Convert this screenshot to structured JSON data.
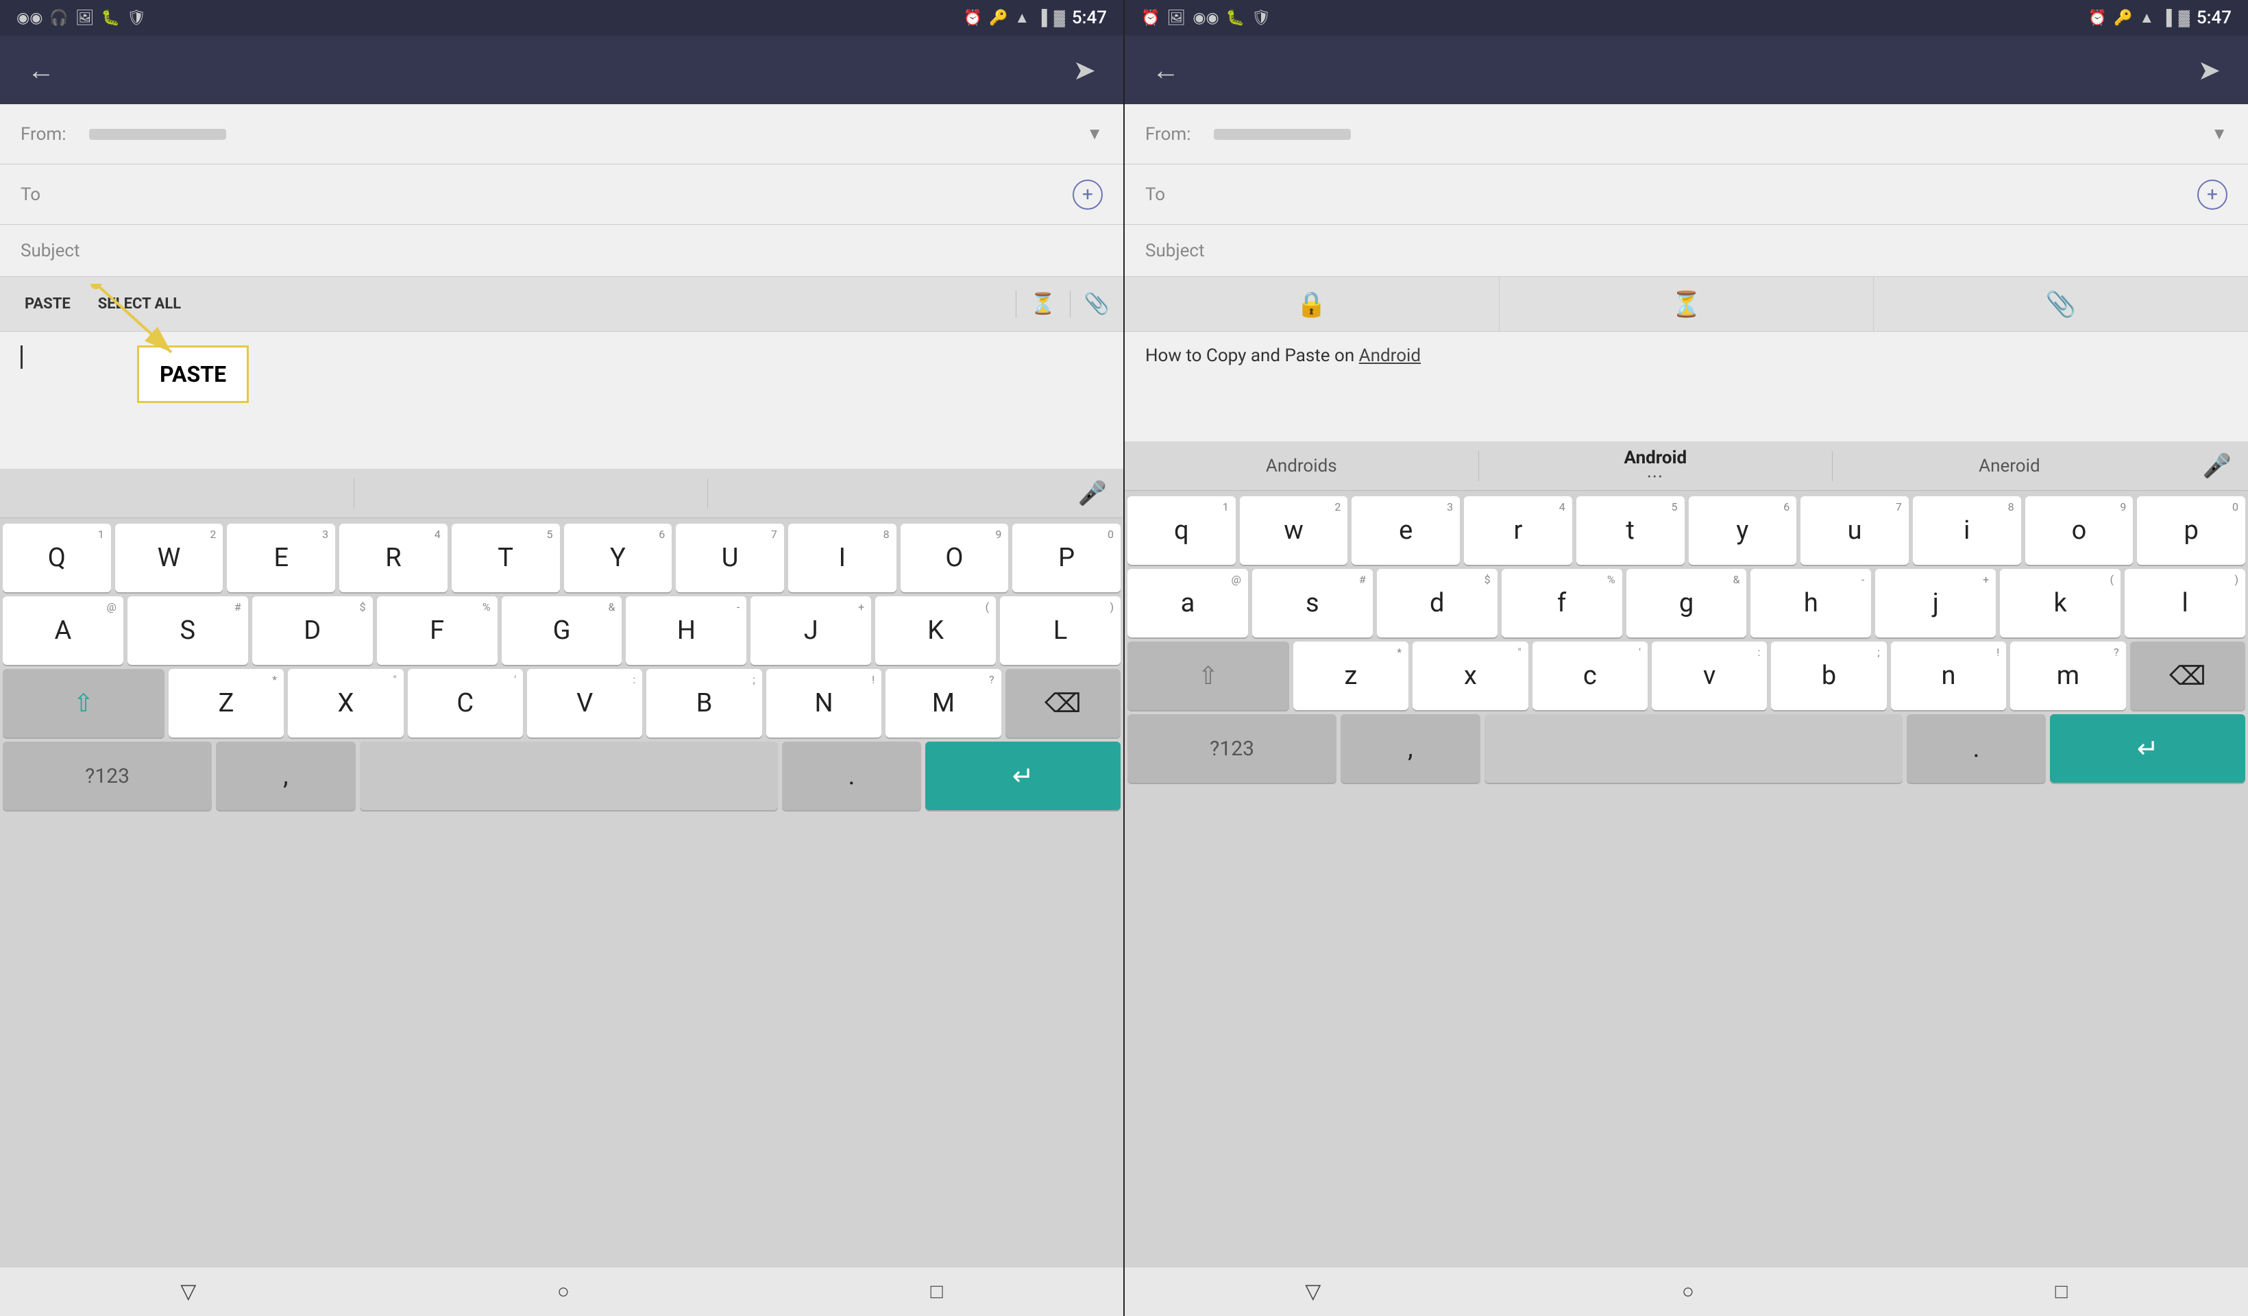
{
  "left_phone": {
    "status_bar": {
      "time": "5:47",
      "icons_left": [
        "voicemail",
        "headset",
        "image",
        "bug",
        "shield"
      ],
      "icons_right": [
        "alarm",
        "key",
        "wifi",
        "signal",
        "battery"
      ]
    },
    "app_bar": {
      "back_label": "←",
      "send_label": "➤"
    },
    "from_label": "From:",
    "to_label": "To",
    "subject_label": "Subject",
    "toolbar": {
      "paste_label": "PASTE",
      "select_all_label": "SELECT ALL",
      "timer_icon": "⏳",
      "attach_icon": "📎"
    },
    "paste_popup": {
      "label": "PASTE"
    },
    "keyboard": {
      "autocorrect": [
        "",
        "",
        ""
      ],
      "rows": [
        [
          "Q",
          "W",
          "E",
          "R",
          "T",
          "Y",
          "U",
          "I",
          "O",
          "P"
        ],
        [
          "A",
          "S",
          "D",
          "F",
          "G",
          "H",
          "J",
          "K",
          "L"
        ],
        [
          "Z",
          "X",
          "C",
          "V",
          "B",
          "N",
          "M"
        ]
      ],
      "nums": [
        "1",
        "2",
        "3",
        "4",
        "5",
        "6",
        "7",
        "8",
        "9",
        "0"
      ],
      "bottom": [
        "?123",
        ",",
        "",
        ".",
        "↵"
      ]
    }
  },
  "right_phone": {
    "status_bar": {
      "time": "5:47",
      "icons_left": [
        "alarm",
        "image",
        "voicemail",
        "bug",
        "shield"
      ],
      "icons_right": [
        "alarm",
        "key",
        "wifi",
        "signal",
        "battery"
      ]
    },
    "app_bar": {
      "back_label": "←",
      "send_label": "➤"
    },
    "from_label": "From:",
    "to_label": "To",
    "subject_label": "Subject",
    "toolbar_icons": [
      "🔒",
      "⏳",
      "📎"
    ],
    "body_text": "How to Copy and Paste on ",
    "body_link": "Android",
    "keyboard": {
      "autocorrect": [
        "Androids",
        "Android",
        "Aneroid"
      ],
      "rows": [
        [
          "q",
          "w",
          "e",
          "r",
          "t",
          "y",
          "u",
          "i",
          "o",
          "p"
        ],
        [
          "a",
          "s",
          "d",
          "f",
          "g",
          "h",
          "j",
          "k",
          "l"
        ],
        [
          "z",
          "x",
          "c",
          "v",
          "b",
          "n",
          "m"
        ]
      ],
      "nums": [
        "1",
        "2",
        "3",
        "4",
        "5",
        "6",
        "7",
        "8",
        "9",
        "0"
      ],
      "bottom": [
        "?123",
        ",",
        "",
        ".",
        "↵"
      ]
    }
  },
  "nav": {
    "back": "▽",
    "home": "○",
    "recents": "□"
  }
}
